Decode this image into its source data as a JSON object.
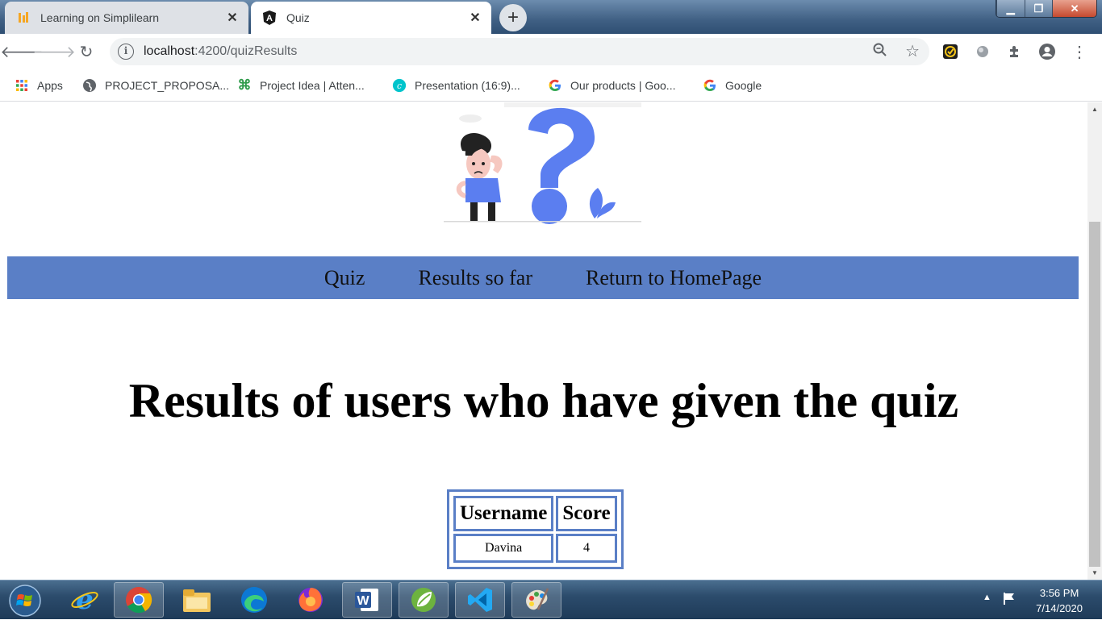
{
  "tabs": [
    {
      "title": "Learning on Simplilearn",
      "active": false,
      "icon": "simplilearn-icon"
    },
    {
      "title": "Quiz",
      "active": true,
      "icon": "angular-icon"
    }
  ],
  "address_bar": {
    "url_host": "localhost",
    "url_path": ":4200/quizResults"
  },
  "bookmarks": [
    {
      "label": "Apps",
      "icon": "apps-grid-icon"
    },
    {
      "label": "PROJECT_PROPOSA...",
      "icon": "globe-icon"
    },
    {
      "label": "Project Idea | Atten...",
      "icon": "project-idea-icon"
    },
    {
      "label": "Presentation (16:9)...",
      "icon": "canva-icon"
    },
    {
      "label": "Our products | Goo...",
      "icon": "google-icon"
    },
    {
      "label": "Google",
      "icon": "google-icon"
    }
  ],
  "page": {
    "nav": {
      "quiz": "Quiz",
      "results": "Results so far",
      "home": "Return to HomePage"
    },
    "heading": "Results of users who have given the quiz",
    "table": {
      "headers": [
        "Username",
        "Score"
      ],
      "rows": [
        {
          "username": "Davina",
          "score": "4"
        }
      ]
    }
  },
  "taskbar": {
    "apps": [
      "internet-explorer-icon",
      "chrome-icon",
      "file-explorer-icon",
      "edge-icon",
      "firefox-icon",
      "word-icon",
      "spring-tools-icon",
      "vscode-icon",
      "paint-icon"
    ],
    "time": "3:56 PM",
    "date": "7/14/2020"
  },
  "colors": {
    "accent": "#5a7fc6",
    "taskbar": "#2c4c6c"
  }
}
